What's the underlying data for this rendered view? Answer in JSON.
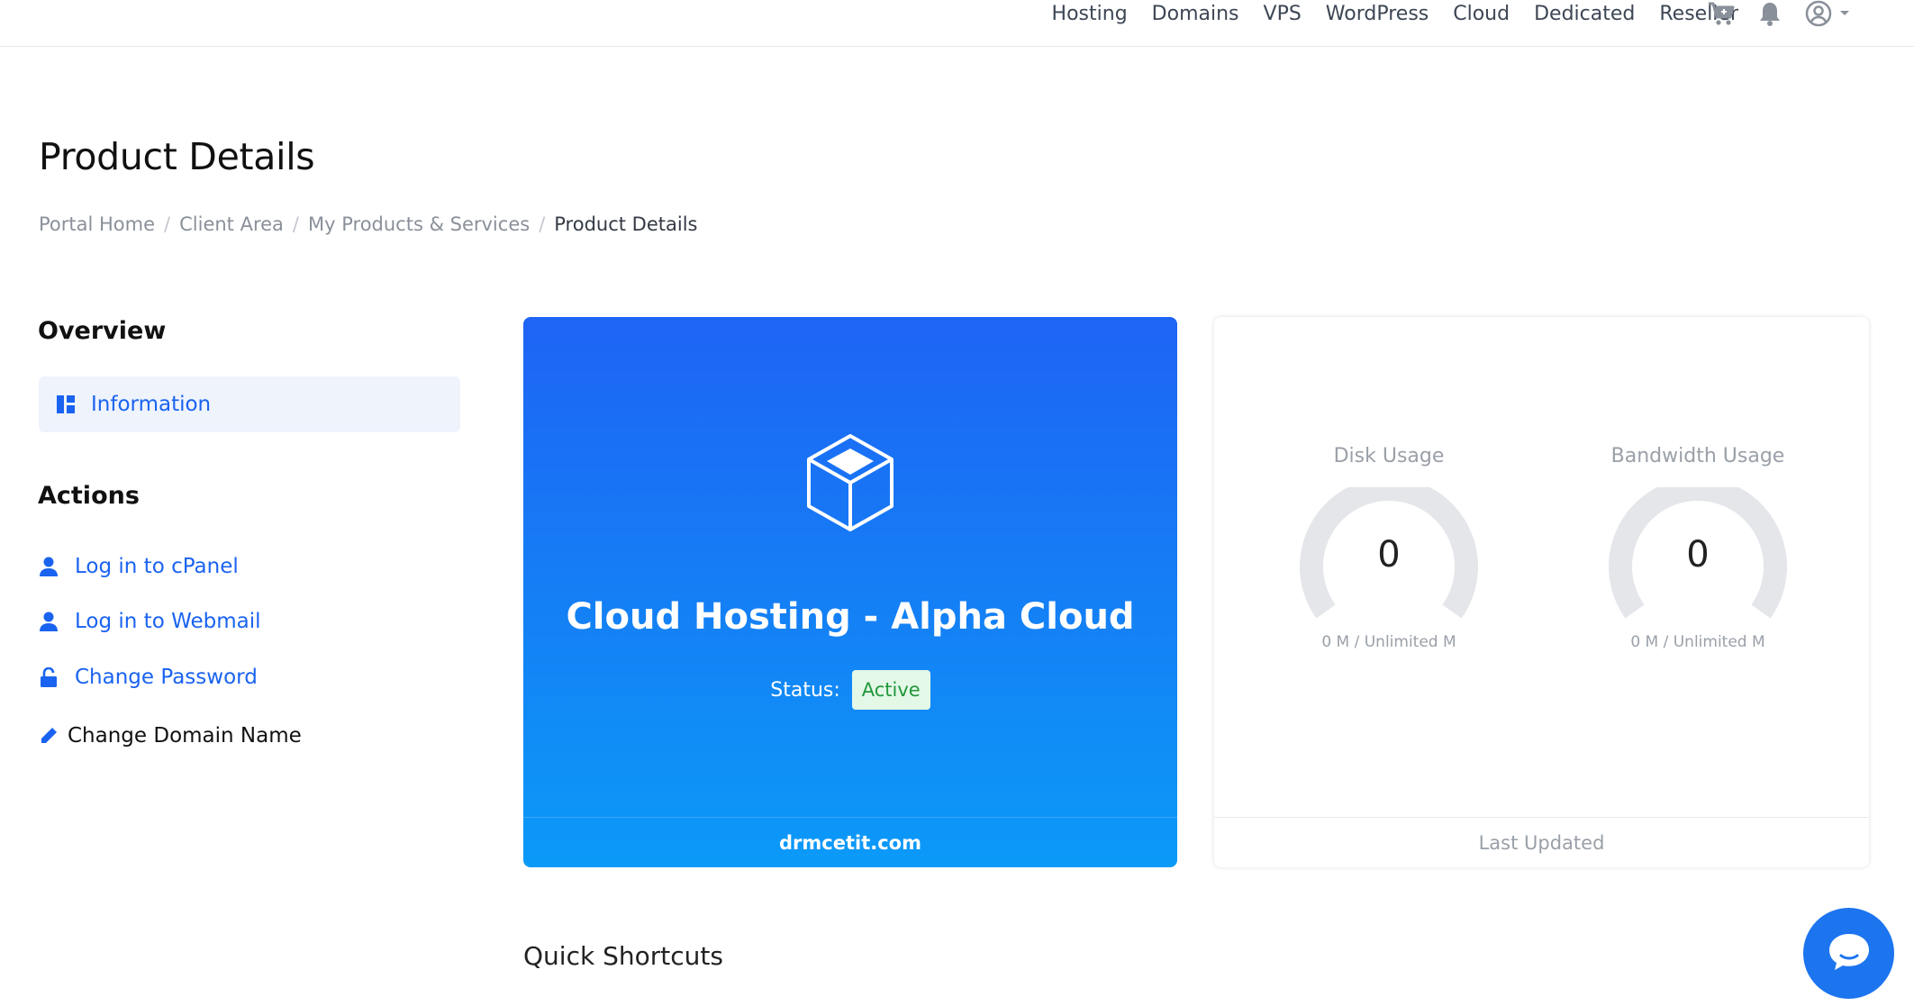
{
  "nav": {
    "links": [
      "Hosting",
      "Domains",
      "VPS",
      "WordPress",
      "Cloud",
      "Dedicated",
      "Reseller"
    ],
    "icons": [
      "cart-icon",
      "bell-icon",
      "user-circle-icon",
      "caret-down-icon"
    ]
  },
  "page": {
    "title": "Product Details",
    "breadcrumb": [
      "Portal Home",
      "Client Area",
      "My Products & Services",
      "Product Details"
    ]
  },
  "sidebar": {
    "overview_heading": "Overview",
    "overview_item": "Information",
    "actions_heading": "Actions",
    "actions": [
      "Log in to cPanel",
      "Log in to Webmail",
      "Change Password",
      "Change Domain Name"
    ]
  },
  "product": {
    "name": "Cloud Hosting - Alpha Cloud",
    "status_label": "Status:",
    "status_value": "Active",
    "domain": "drmcetit.com"
  },
  "usage": {
    "disk": {
      "title": "Disk Usage",
      "value": "0",
      "caption": "0 M / Unlimited M"
    },
    "bandwidth": {
      "title": "Bandwidth Usage",
      "value": "0",
      "caption": "0 M / Unlimited M"
    },
    "footer": "Last Updated"
  },
  "shortcuts": {
    "title": "Quick Shortcuts"
  },
  "colors": {
    "accent": "#1a63f0",
    "card_top": "#1e64f5",
    "card_bottom": "#0b9af8",
    "active_bg": "#e3f8e7",
    "active_text": "#22973b"
  }
}
